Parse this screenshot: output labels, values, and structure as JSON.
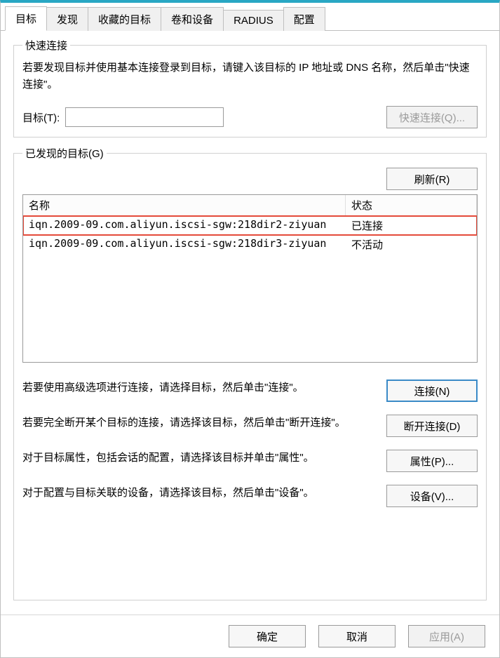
{
  "tabs": [
    {
      "label": "目标",
      "active": true
    },
    {
      "label": "发现",
      "active": false
    },
    {
      "label": "收藏的目标",
      "active": false
    },
    {
      "label": "卷和设备",
      "active": false
    },
    {
      "label": "RADIUS",
      "active": false
    },
    {
      "label": "配置",
      "active": false
    }
  ],
  "quick_connect": {
    "legend": "快速连接",
    "desc": "若要发现目标并使用基本连接登录到目标，请键入该目标的 IP 地址或 DNS 名称，然后单击\"快速连接\"。",
    "target_label": "目标(T):",
    "target_value": "",
    "button": "快速连接(Q)..."
  },
  "discovered": {
    "legend": "已发现的目标(G)",
    "refresh": "刷新(R)",
    "columns": {
      "name": "名称",
      "state": "状态"
    },
    "rows": [
      {
        "name": "iqn.2009-09.com.aliyun.iscsi-sgw:218dir2-ziyuan",
        "state": "已连接",
        "highlight": true
      },
      {
        "name": "iqn.2009-09.com.aliyun.iscsi-sgw:218dir3-ziyuan",
        "state": "不活动",
        "highlight": false
      }
    ]
  },
  "actions": {
    "connect": {
      "text": "若要使用高级选项进行连接，请选择目标，然后单击\"连接\"。",
      "button": "连接(N)"
    },
    "disconnect": {
      "text": "若要完全断开某个目标的连接，请选择该目标，然后单击\"断开连接\"。",
      "button": "断开连接(D)"
    },
    "properties": {
      "text": "对于目标属性，包括会话的配置，请选择该目标并单击\"属性\"。",
      "button": "属性(P)..."
    },
    "devices": {
      "text": "对于配置与目标关联的设备，请选择该目标，然后单击\"设备\"。",
      "button": "设备(V)..."
    }
  },
  "footer": {
    "ok": "确定",
    "cancel": "取消",
    "apply": "应用(A)"
  }
}
